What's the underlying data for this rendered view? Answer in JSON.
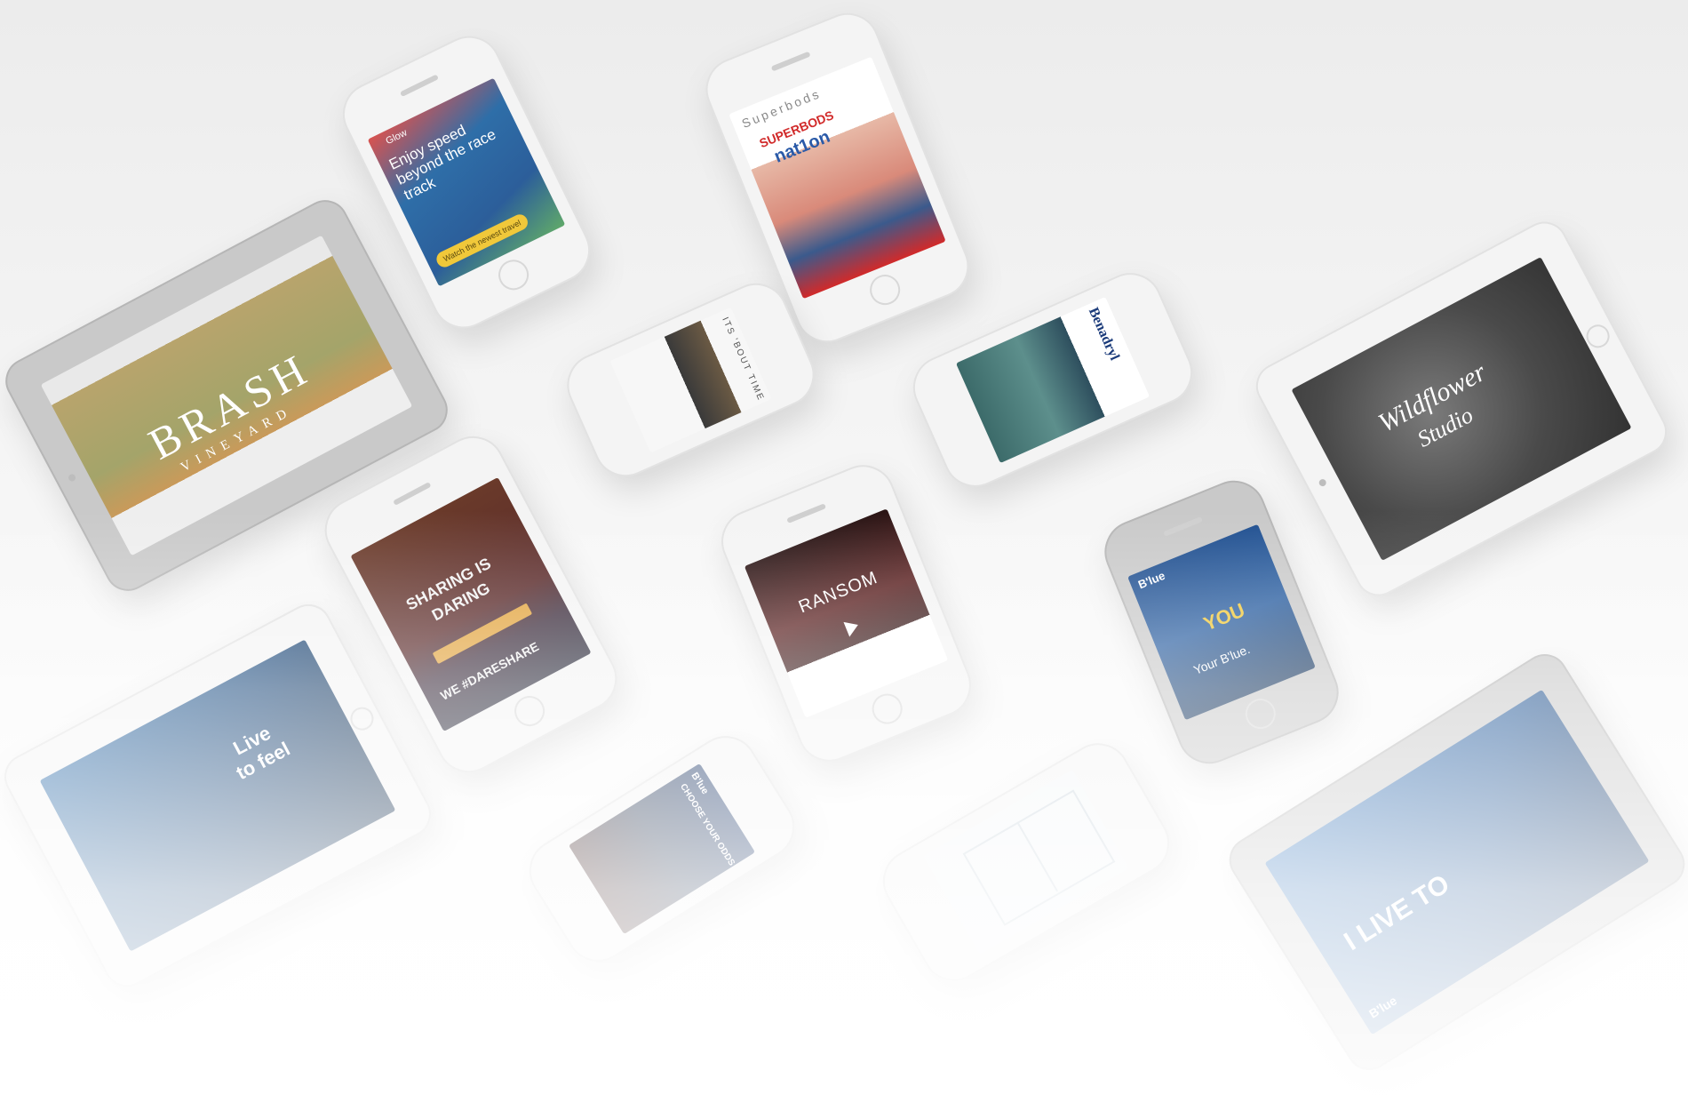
{
  "devices": {
    "brash": {
      "logo": "BRASH",
      "sub": "VINEYARD",
      "colors": {
        "sky": "#9aa3a3",
        "foliage": "#b8a46c"
      }
    },
    "glow": {
      "brand": "Glow",
      "headline": "Enjoy speed beyond the race track",
      "cta": "Watch the newest travel",
      "colors": {
        "bg": "#2e6ea8",
        "cta": "#f0c83a"
      }
    },
    "superbods": {
      "brand": "Superbods",
      "headline": "SUPERBODS",
      "logo": "nat1on",
      "colors": {
        "accent": "#d12a2a"
      }
    },
    "watch": {
      "headline": "ITS 'BOUT TIME",
      "colors": {
        "dark": "#3a3a3a"
      }
    },
    "benadryl": {
      "brand": "Benadryl",
      "colors": {
        "bg": "#5d8f8c"
      }
    },
    "wildflower": {
      "logo_line1": "Wildflower",
      "logo_line2": "Studio",
      "colors": {
        "bg": "#4a4a4a"
      }
    },
    "daring": {
      "headline_1": "SHARING IS",
      "headline_2": "DARING",
      "tag": "WE #DARESHARE",
      "colors": {
        "bg": "#5a2a2a",
        "cta": "#e2a33c"
      }
    },
    "ransom": {
      "headline": "RANSOM",
      "colors": {
        "bg": "#3a1a1a"
      }
    },
    "blue": {
      "brand": "B'lue",
      "badge": "YOU",
      "tagline": "Your B'lue.",
      "colors": {
        "bg": "#2a5ea0"
      }
    },
    "livetofeel": {
      "headline_1": "Live",
      "headline_2": "to feel",
      "colors": {
        "bg": "#1f4a7a"
      }
    },
    "choose": {
      "brand": "B'lue",
      "headline": "CHOOSE YOUR ODDS",
      "colors": {
        "bg": "#2a3a55"
      }
    },
    "plan": {
      "colors": {
        "bg": "#f3f6f8",
        "line": "#c9d4dc"
      }
    },
    "livetofly": {
      "headline": "I LIVE TO",
      "brand": "B'lue",
      "colors": {
        "bg": "#2a5d9a"
      }
    }
  }
}
